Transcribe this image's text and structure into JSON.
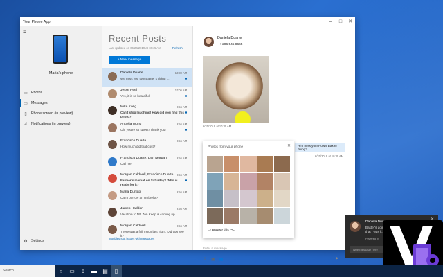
{
  "window": {
    "title": "Your Phone App",
    "controls": [
      "–",
      "□",
      "✕"
    ]
  },
  "sidebar": {
    "menu_icon": "hamburger-icon",
    "phone_icon": "phone-icon",
    "phone_name": "Maria's phone",
    "items": [
      {
        "label": "Photos",
        "icon": "photos-icon",
        "glyph": "▭"
      },
      {
        "label": "Messages",
        "icon": "messages-icon",
        "glyph": "▭",
        "active": true
      },
      {
        "label": "Phone screen (in preview)",
        "icon": "phone-screen-icon",
        "glyph": "▯"
      },
      {
        "label": "Notifications (in preview)",
        "icon": "bell-icon",
        "glyph": "♫"
      }
    ],
    "settings": {
      "label": "Settings",
      "icon": "gear-icon",
      "glyph": "⚙"
    }
  },
  "messages_list": {
    "title": "Recent Posts",
    "updated": "Last updated on 06/20/2019 at 10:45 AM",
    "refresh": "Refresh",
    "new_button": "+ New message",
    "footer_link": "Troubleshoot issues with messages",
    "rows": [
      {
        "name": "Daniela Duarte",
        "preview": "We miss you too! Baxter's doing ...",
        "time": "10:30 AM",
        "unread": true,
        "selected": true,
        "color": "#8a6b55"
      },
      {
        "name": "Jesse Peel",
        "preview": "Yes, it is so beautiful",
        "time": "10:06 AM",
        "unread": true,
        "color": "#b08b6e"
      },
      {
        "name": "Mike Kong",
        "preview": "Can't stop laughing! How did you find this photo?",
        "time": "9:56 AM",
        "unread": true,
        "bold": true,
        "color": "#3f2f26"
      },
      {
        "name": "Angelia Wong",
        "preview": "Oh, you're so sweet! Thank you!",
        "time": "9:56 AM",
        "unread": true,
        "color": "#9b7560"
      },
      {
        "name": "Francisco Duarte",
        "preview": "How much did that cost?",
        "time": "9:56 AM",
        "unread": false,
        "color": "#6e5446"
      },
      {
        "name": "Francisco Duarte, Dan Morgan",
        "preview": "Call me!",
        "time": "9:56 AM",
        "unread": false,
        "color": "#2f79c9"
      },
      {
        "name": "Morgan Caldwell, Francisco Duarte",
        "preview": "Farmer's market on Saturday? Who is ready for it?",
        "time": "9:56 AM",
        "unread": true,
        "bold": true,
        "color": "#d44b3c"
      },
      {
        "name": "Maria Dunlap",
        "preview": "Can I borrow an umbrella?",
        "time": "9:56 AM",
        "unread": false,
        "color": "#c49b84"
      },
      {
        "name": "James Hadden",
        "preview": "Vacation to Mt. Zen Keep is coming up",
        "time": "9:56 AM",
        "unread": false,
        "color": "#5d4437"
      },
      {
        "name": "Morgan Caldwell",
        "preview": "There was a full moon last night. Did you see it?",
        "time": "9:56 AM",
        "unread": false,
        "color": "#7a5a48"
      }
    ]
  },
  "conversation": {
    "contact_name": "Daniela Duarte",
    "contact_phone": "+ 206 545 8665",
    "photo_time": "6/20/2019 at 10:30 AM",
    "outgoing_text": "Hi! I miss you! How's Baxter doing?",
    "outgoing_time": "6/20/2019 at 10:30 AM",
    "compose_placeholder": "Enter a message",
    "toolbar_icons": [
      "emoji-icon",
      "gif-icon",
      "image-icon"
    ],
    "toolbar_glyphs": [
      "☺",
      "▣",
      "▦"
    ],
    "send_icon": "send-icon",
    "send_glyph": "➤"
  },
  "photos_popup": {
    "title": "Photos from your phone",
    "close": "✕",
    "browse_label": "Browse this PC",
    "browse_icon": "folder-icon",
    "thumbnails": [
      "#b9a490",
      "#c88f6a",
      "#e0b8a0",
      "#a97b52",
      "#8c6a4e",
      "#7fa3b8",
      "#d7b596",
      "#c9a2a8",
      "#b28365",
      "#d9c6b4",
      "#6f8fa3",
      "#c6c0c8",
      "#d4c7cf",
      "#ccb08a",
      "#e2d7c6",
      "#7c6a5a",
      "#9b7a66",
      "#b8b2a8",
      "#a68c70",
      "#ccd6da"
    ]
  },
  "toast": {
    "name": "Daniela Duarte",
    "message": "Baxter's doing that I was li...",
    "powered": "Powered by",
    "reply_placeholder": "Type message here",
    "close": "✕"
  },
  "taskbar": {
    "search_placeholder": "Search",
    "icons": [
      {
        "name": "cortana-icon",
        "glyph": "○"
      },
      {
        "name": "task-view-icon",
        "glyph": "▭"
      },
      {
        "name": "edge-icon",
        "glyph": "e"
      },
      {
        "name": "file-explorer-icon",
        "glyph": "▬"
      },
      {
        "name": "store-icon",
        "glyph": "▤"
      },
      {
        "name": "your-phone-icon",
        "glyph": "▯",
        "active": true
      }
    ]
  },
  "colors": {
    "accent": "#0078d7",
    "selected_row": "#cfe2f5",
    "desktop": "#1f5bb8"
  }
}
